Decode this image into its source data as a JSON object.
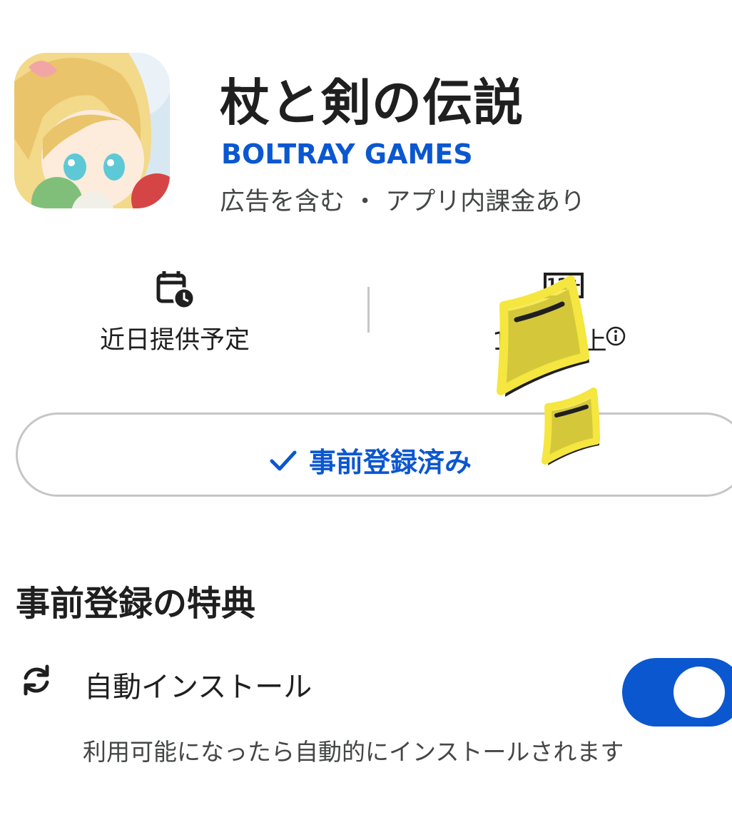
{
  "app": {
    "title": "杖と剣の伝説",
    "developer": "BOLTRAY GAMES",
    "meta": "広告を含む ・ アプリ内課金あり"
  },
  "info": {
    "release_label": "近日提供予定",
    "age_badge": "12+",
    "age_label": "12 歳以上"
  },
  "prereg_button": {
    "label": "事前登録済み"
  },
  "rewards": {
    "section_title": "事前登録の特典",
    "auto_install_label": "自動インストール",
    "auto_install_on": true,
    "auto_install_desc": "利用可能になったら自動的にインストールされます"
  },
  "colors": {
    "accent": "#0b57d0",
    "sticker": "#f5e640",
    "text": "#1f1f1f",
    "muted": "#444746"
  },
  "icons": [
    "app-icon",
    "calendar-clock-icon",
    "age-rating-icon",
    "info-icon",
    "check-icon",
    "sync-icon"
  ]
}
